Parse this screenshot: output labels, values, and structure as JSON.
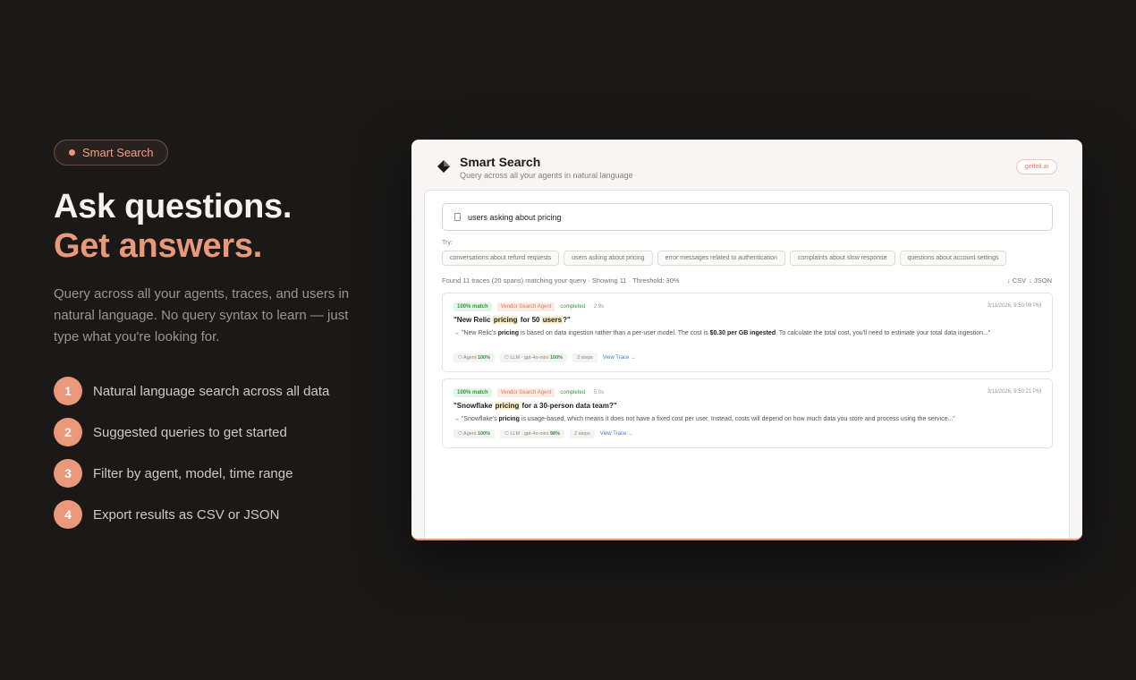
{
  "hero": {
    "pill": "Smart Search",
    "title_line1": "Ask questions.",
    "title_line2": "Get answers.",
    "description": "Query across all your agents, traces, and users in natural language. No query syntax to learn — just type what you're looking for.",
    "features": [
      {
        "num": "1",
        "text": "Natural language search across all data"
      },
      {
        "num": "2",
        "text": "Suggested queries to get started"
      },
      {
        "num": "3",
        "text": "Filter by agent, model, time range"
      },
      {
        "num": "4",
        "text": "Export results as CSV or JSON"
      }
    ]
  },
  "app": {
    "title": "Smart Search",
    "subtitle": "Query across all your agents in natural language",
    "badge": "getfoil.ai",
    "search_value": "users asking about pricing",
    "try_label": "Try:",
    "suggestions": [
      "conversations about refund requests",
      "users asking about pricing",
      "error messages related to authentication",
      "complaints about slow response",
      "questions about account settings"
    ],
    "summary": "Found 11 traces (20 spans) matching your query · Showing 11 · Threshold: 30%",
    "export_csv": "↓ CSV",
    "export_json": "↓ JSON",
    "results": [
      {
        "match": "100% match",
        "agent": "Vendor Search Agent",
        "status": "completed",
        "duration": "· 2.9s",
        "date": "3/11/2026, 9:50:09 PM",
        "title_a": "\"New Relic ",
        "title_h1": "pricing",
        "title_b": " for 50 ",
        "title_h2": "users",
        "title_c": "?\"",
        "snip_a": "→ \"New Relic's ",
        "snip_b1": "pricing",
        "snip_c": " is based on data ingestion rather than a per-user model. The cost is ",
        "snip_b2": "$0.30 per GB ingested",
        "snip_d": ". To calculate the total cost, you'll need to estimate your total data ingestion...\"",
        "meta_agent": "⎔ Agent ",
        "meta_agent_pct": "100%",
        "meta_llm": "⎔ LLM · gpt-4o-mini ",
        "meta_llm_pct": "100%",
        "steps": "2 steps",
        "link": "View Trace →"
      },
      {
        "match": "100% match",
        "agent": "Vendor Search Agent",
        "status": "completed",
        "duration": "· 5.0s",
        "date": "3/11/2026, 9:50:21 PM",
        "title_a": "\"Snowflake ",
        "title_h1": "pricing",
        "title_b": " for a 30-person data team?\"",
        "snip_a": "→ \"Snowflake's ",
        "snip_b1": "pricing",
        "snip_c": " is usage-based, which means it does not have a fixed cost per user. Instead, costs will depend on how much data you store and process using the service...\"",
        "meta_agent": "⎔ Agent ",
        "meta_agent_pct": "100%",
        "meta_llm": "⎔ LLM · gpt-4o-mini ",
        "meta_llm_pct": "98%",
        "steps": "2 steps",
        "link": "View Trace →"
      }
    ]
  },
  "colors": {
    "accent": "#e9987a",
    "background": "#1a1918",
    "success": "#2c9a3c",
    "link": "#3b7ddd"
  }
}
